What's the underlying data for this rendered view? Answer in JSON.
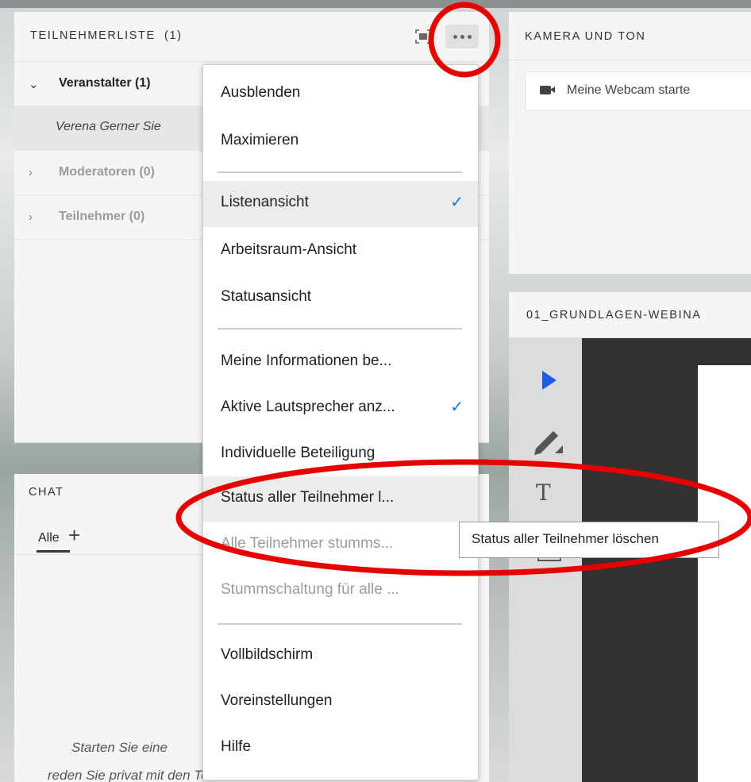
{
  "participants": {
    "title": "TEILNEHMERLISTE",
    "count": "(1)",
    "rows": [
      {
        "chevron": "⌄",
        "label": "Veranstalter (1)"
      },
      {
        "label": "Verena Gerner Sie"
      },
      {
        "chevron": "›",
        "label": "Moderatoren (0)"
      },
      {
        "chevron": "›",
        "label": "Teilnehmer (0)"
      }
    ]
  },
  "camera": {
    "title": "KAMERA UND TON",
    "button_label": "Meine Webcam starte"
  },
  "share": {
    "title": "01_GRUNDLAGEN-WEBINA"
  },
  "chat": {
    "title": "CHAT",
    "tab_label": "Alle",
    "add_label": "+",
    "hint_line1": "Starten Sie eine",
    "hint_line2": "reden Sie privat mit den Teilnehmern. Moderatoren"
  },
  "menu": {
    "items": [
      {
        "label": "Ausblenden"
      },
      {
        "label": "Maximieren"
      },
      {
        "label": "Listenansicht",
        "checked": true
      },
      {
        "label": "Arbeitsraum-Ansicht"
      },
      {
        "label": "Statusansicht"
      },
      {
        "label": "Meine Informationen be..."
      },
      {
        "label": "Aktive Lautsprecher anz...",
        "checked": true
      },
      {
        "label": "Individuelle Beteiligung"
      },
      {
        "label": "Status aller Teilnehmer l..."
      },
      {
        "label": "Alle Teilnehmer stumms...",
        "disabled": true
      },
      {
        "label": "Stummschaltung für alle ...",
        "disabled": true
      },
      {
        "label": "Vollbildschirm"
      },
      {
        "label": "Voreinstellungen"
      },
      {
        "label": "Hilfe"
      }
    ],
    "check_glyph": "✓"
  },
  "tooltip": {
    "text": "Status aller Teilnehmer löschen"
  },
  "colors": {
    "accent": "#1473e6",
    "annotation": "#e60000",
    "tool_select": "#1a5ce6"
  }
}
